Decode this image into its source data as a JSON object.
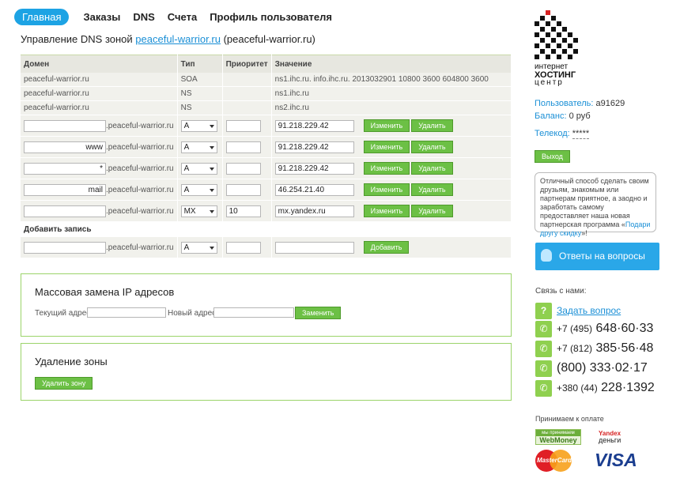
{
  "nav": {
    "items": [
      "Главная",
      "Заказы",
      "DNS",
      "Счета",
      "Профиль пользователя"
    ]
  },
  "title": {
    "prefix": "Управление DNS зоной",
    "domain_link": "peaceful-warrior.ru",
    "suffix": "(peaceful-warrior.ru)"
  },
  "table": {
    "headers": [
      "Домен",
      "Тип",
      "Приоритет",
      "Значение"
    ],
    "readonly_rows": [
      {
        "domain": "peaceful-warrior.ru",
        "type": "SOA",
        "priority": "",
        "value": "ns1.ihc.ru. info.ihc.ru. 2013032901 10800 3600 604800 3600"
      },
      {
        "domain": "peaceful-warrior.ru",
        "type": "NS",
        "priority": "",
        "value": "ns1.ihc.ru"
      },
      {
        "domain": "peaceful-warrior.ru",
        "type": "NS",
        "priority": "",
        "value": "ns2.ihc.ru"
      }
    ],
    "domain_suffix": ".peaceful-warrior.ru",
    "edit_rows": [
      {
        "sub": "",
        "type": "A",
        "priority": "",
        "value": "91.218.229.42"
      },
      {
        "sub": "www",
        "type": "A",
        "priority": "",
        "value": "91.218.229.42"
      },
      {
        "sub": "*",
        "type": "A",
        "priority": "",
        "value": "91.218.229.42"
      },
      {
        "sub": "mail",
        "type": "A",
        "priority": "",
        "value": "46.254.21.40"
      },
      {
        "sub": "",
        "type": "MX",
        "priority": "10",
        "value": "mx.yandex.ru"
      }
    ],
    "edit_label": "Изменить",
    "delete_label": "Удалить",
    "add_title": "Добавить запись",
    "add_row": {
      "sub": "",
      "type": "A",
      "priority": "",
      "value": ""
    },
    "add_label": "Добавить"
  },
  "mass": {
    "title": "Массовая замена IP адресов",
    "current_label": "Текущий адрес:",
    "new_label": "Новый адрес:",
    "button": "Заменить"
  },
  "delete_zone": {
    "title": "Удаление зоны",
    "button": "Удалить зону"
  },
  "logo": {
    "line1": "интернет",
    "line2": "хостинг",
    "line3": "центр"
  },
  "account": {
    "user_label": "Пользователь:",
    "user_value": "a91629",
    "balance_label": "Баланс:",
    "balance_value": "0 руб",
    "telecode_label": "Телекод:",
    "telecode_value": "*****",
    "exit_label": "Выход"
  },
  "promo": {
    "text": "Отличный способ сделать своим друзьям, знакомым или партнерам приятное, а заодно и заработать самому предоставляет наша новая партнерская программа «",
    "link": "Подари другу скидку",
    "end": "»!"
  },
  "faq_label": "Ответы на вопросы",
  "contacts": {
    "title": "Связь с нами:",
    "ask": "Задать вопрос",
    "phones": [
      {
        "prefix": "+7 (495)",
        "number": "648·60·33"
      },
      {
        "prefix": "+7 (812)",
        "number": "385·56·48"
      },
      {
        "prefix": "",
        "number": "(800) 333·02·17"
      },
      {
        "prefix": "+380 (44)",
        "number": "228·1392"
      }
    ]
  },
  "payment": {
    "title": "Принимаем к оплате",
    "webmoney": "WebMoney",
    "webmoney_top": "мы принимаем",
    "yandex_top": "Yandex",
    "yandex": "деньги",
    "mastercard": "MasterCard",
    "visa": "VISA"
  },
  "colors": {
    "accent": "#1da3e4",
    "button_green": "#6cc045",
    "panel_border": "#9bd46a",
    "row_bg": "#f1f1ec"
  }
}
